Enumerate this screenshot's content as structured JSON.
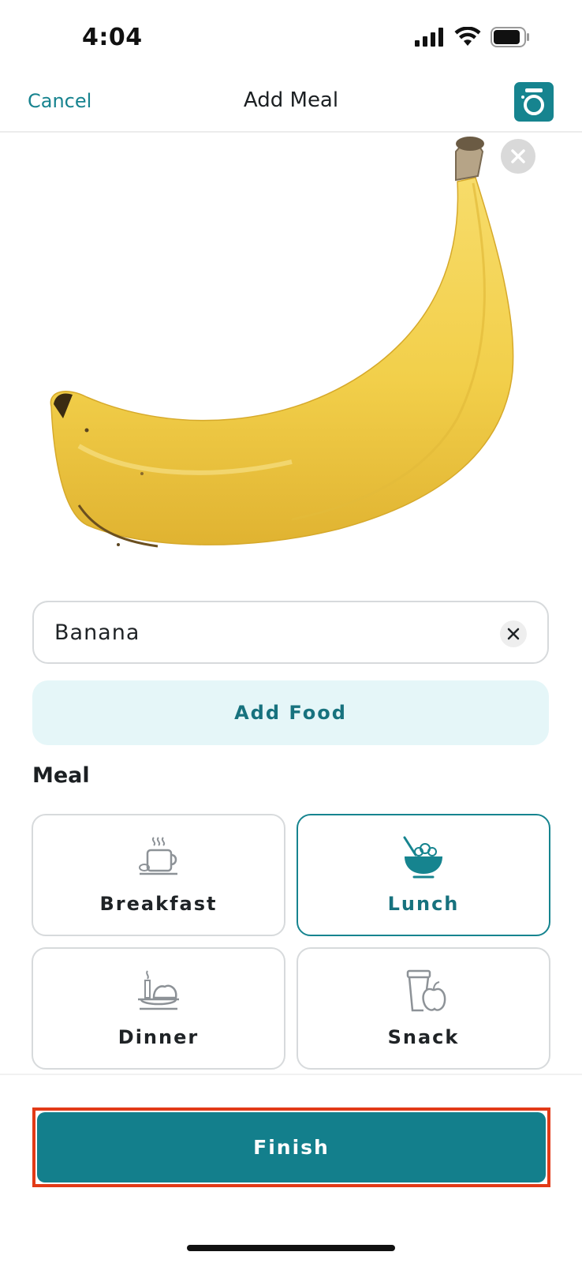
{
  "status_bar": {
    "time": "4:04"
  },
  "nav": {
    "cancel_label": "Cancel",
    "title": "Add Meal"
  },
  "photo": {
    "subject_icon": "banana-image"
  },
  "food_entry": {
    "value": "Banana"
  },
  "add_food_label": "Add Food",
  "meal_section": {
    "label": "Meal",
    "options": [
      {
        "label": "Breakfast",
        "icon": "coffee-cup-icon",
        "selected": false
      },
      {
        "label": "Lunch",
        "icon": "bowl-icon",
        "selected": true
      },
      {
        "label": "Dinner",
        "icon": "dinner-plate-icon",
        "selected": false
      },
      {
        "label": "Snack",
        "icon": "snack-apple-icon",
        "selected": false
      }
    ]
  },
  "finish_label": "Finish",
  "colors": {
    "accent": "#16848f",
    "accent_text": "#17727e",
    "add_food_bg": "#e5f6f8",
    "highlight": "#e23a17"
  }
}
